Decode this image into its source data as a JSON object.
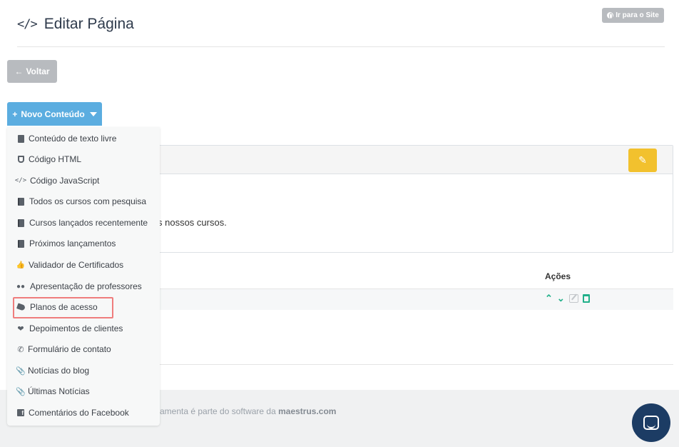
{
  "header": {
    "icon": "code-icon",
    "title": "Editar Página",
    "site_button": "Ir para o Site"
  },
  "toolbar": {
    "back_label": "Voltar",
    "new_content_label": "Novo Conteúdo"
  },
  "panel": {
    "text": "s nossos cursos."
  },
  "table": {
    "actions_header": "Ações"
  },
  "footer": {
    "text_prefix": "amenta é parte do software da ",
    "brand": "maestrus.com"
  },
  "colors": {
    "primary": "#5bade0",
    "warning": "#f2c12e",
    "success": "#22b08a",
    "gray_button": "#b8bbbf",
    "chat": "#1c3c64",
    "highlight": "#ef7d7d"
  },
  "dropdown": {
    "items": [
      {
        "icon": "file-icon",
        "label": "Conteúdo de texto livre"
      },
      {
        "icon": "html5-icon",
        "label": "Código HTML"
      },
      {
        "icon": "code-icon",
        "label": "Código JavaScript"
      },
      {
        "icon": "book-icon",
        "label": "Todos os cursos com pesquisa"
      },
      {
        "icon": "book-icon",
        "label": "Cursos lançados recentemente"
      },
      {
        "icon": "book-icon",
        "label": "Próximos lançamentos"
      },
      {
        "icon": "thumbs-up-icon",
        "label": "Validador de Certificados"
      },
      {
        "icon": "users-icon",
        "label": "Apresentação de professores"
      },
      {
        "icon": "tags-icon",
        "label": "Planos de acesso"
      },
      {
        "icon": "heart-icon",
        "label": "Depoimentos de clientes"
      },
      {
        "icon": "phone-icon",
        "label": "Formulário de contato"
      },
      {
        "icon": "paperclip-icon",
        "label": "Notícias do blog"
      },
      {
        "icon": "paperclip-icon",
        "label": "Últimas Notícias"
      },
      {
        "icon": "facebook-icon",
        "label": "Comentários do Facebook"
      }
    ]
  }
}
